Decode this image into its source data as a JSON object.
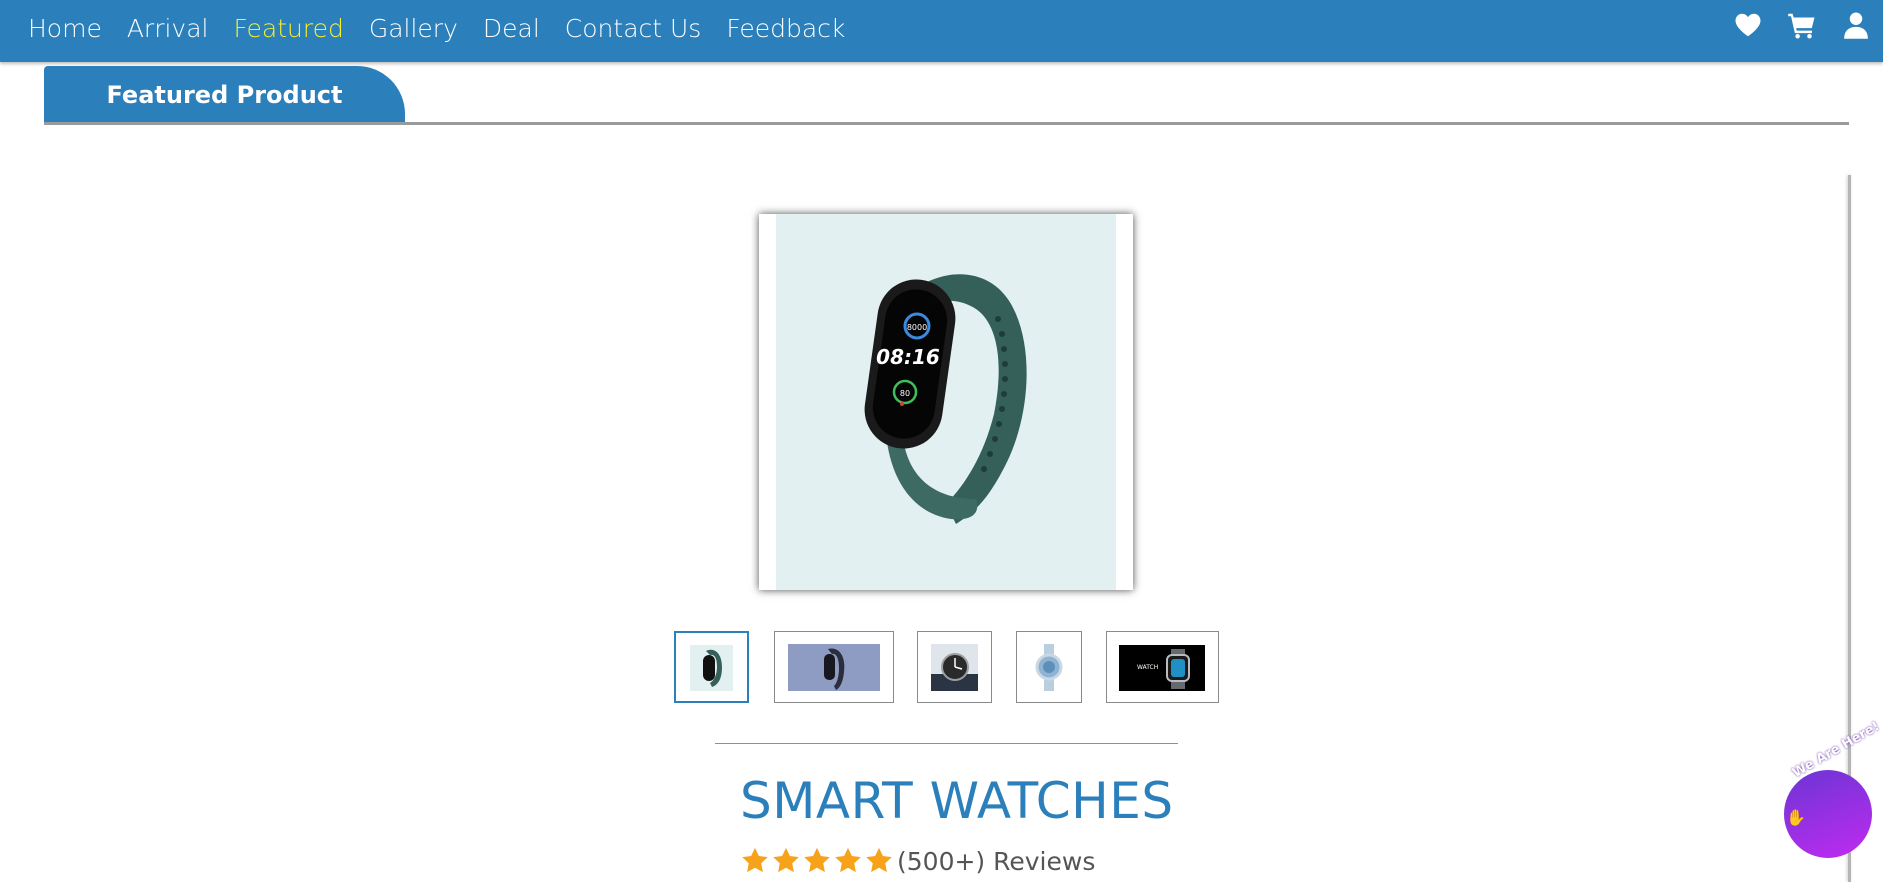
{
  "nav": {
    "links": [
      "Home",
      "Arrival",
      "Featured",
      "Gallery",
      "Deal",
      "Contact Us",
      "Feedback"
    ],
    "active": "Featured",
    "icons": [
      "heart-icon",
      "cart-icon",
      "user-icon"
    ]
  },
  "section": {
    "title": "Featured Product"
  },
  "product": {
    "name": "SMART WATCHES",
    "rating_stars": 5,
    "reviews": "(500+) Reviews",
    "main_image": "green fitness band watch",
    "thumbnails": [
      "green fitness band",
      "blue band watch",
      "round steel watch",
      "light blue round watch",
      "apple watch banner"
    ],
    "selected_thumbnail": 0
  },
  "chat": {
    "label": "We Are Here!",
    "icon": "wave-hand-icon"
  },
  "colors": {
    "primary": "#2b7fba",
    "active_nav": "#f6f12a",
    "star": "#f7a21b",
    "chat_gradient": [
      "#6b35d4",
      "#c02bf0"
    ]
  }
}
